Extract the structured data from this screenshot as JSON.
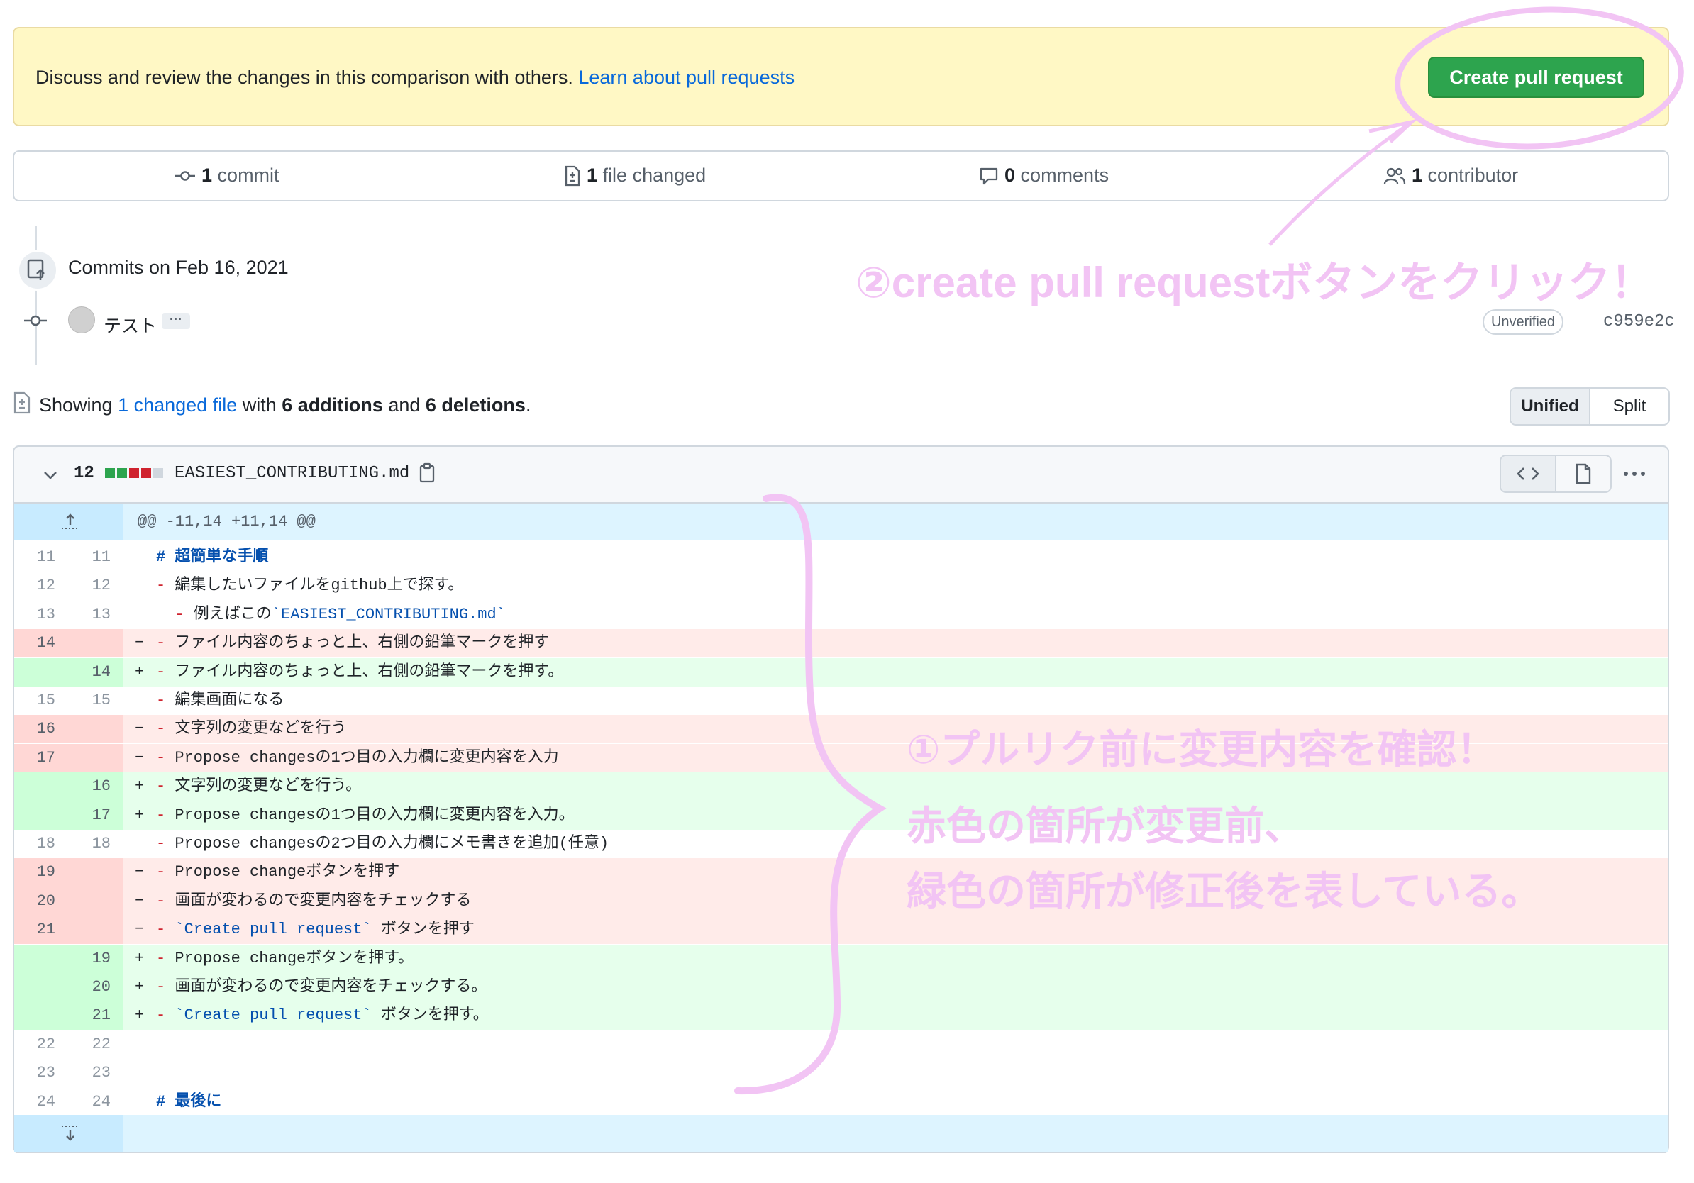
{
  "flash": {
    "text": "Discuss and review the changes in this comparison with others.",
    "link": "Learn about pull requests",
    "button": "Create pull request"
  },
  "summary": {
    "commits_n": "1",
    "commits_label": "commit",
    "files_n": "1",
    "files_label": "file changed",
    "comments_n": "0",
    "comments_label": "comments",
    "contributors_n": "1",
    "contributors_label": "contributor"
  },
  "timeline": {
    "commits_on": "Commits on Feb 16, 2021",
    "author": "テスト",
    "ellipsis": "···",
    "badge": "Unverified",
    "sha": "c959e2c"
  },
  "showing": {
    "prefix": "Showing",
    "link": "1 changed file",
    "mid": "with",
    "additions": "6 additions",
    "and": "and",
    "deletions": "6 deletions",
    "end": "."
  },
  "view_toggle": {
    "unified": "Unified",
    "split": "Split"
  },
  "file": {
    "change_count": "12",
    "name": "EASIEST_CONTRIBUTING.md",
    "stat_colors": [
      "#2da44e",
      "#2da44e",
      "#cf222e",
      "#cf222e",
      "#d0d7de"
    ]
  },
  "hunk_header": "@@ -11,14 +11,14 @@",
  "diff_lines": [
    {
      "type": "ctx",
      "old": "11",
      "new": "11",
      "sign": " ",
      "text": "# 超簡単な手順"
    },
    {
      "type": "ctx",
      "old": "12",
      "new": "12",
      "sign": " ",
      "text": "- 編集したいファイルをgithub上で探す。"
    },
    {
      "type": "ctx",
      "old": "13",
      "new": "13",
      "sign": " ",
      "text": "  - 例えばこの`EASIEST_CONTRIBUTING.md`"
    },
    {
      "type": "del",
      "old": "14",
      "new": "",
      "sign": "−",
      "text": "- ファイル内容のちょっと上、右側の鉛筆マークを押す"
    },
    {
      "type": "add",
      "old": "",
      "new": "14",
      "sign": "+",
      "text": "- ファイル内容のちょっと上、右側の鉛筆マークを押す。"
    },
    {
      "type": "ctx",
      "old": "15",
      "new": "15",
      "sign": " ",
      "text": "- 編集画面になる"
    },
    {
      "type": "del",
      "old": "16",
      "new": "",
      "sign": "−",
      "text": "- 文字列の変更などを行う"
    },
    {
      "type": "del",
      "old": "17",
      "new": "",
      "sign": "−",
      "text": "- Propose changesの1つ目の入力欄に変更内容を入力"
    },
    {
      "type": "add",
      "old": "",
      "new": "16",
      "sign": "+",
      "text": "- 文字列の変更などを行う。"
    },
    {
      "type": "add",
      "old": "",
      "new": "17",
      "sign": "+",
      "text": "- Propose changesの1つ目の入力欄に変更内容を入力。"
    },
    {
      "type": "ctx",
      "old": "18",
      "new": "18",
      "sign": " ",
      "text": "- Propose changesの2つ目の入力欄にメモ書きを追加(任意)"
    },
    {
      "type": "del",
      "old": "19",
      "new": "",
      "sign": "−",
      "text": "- Propose changeボタンを押す"
    },
    {
      "type": "del",
      "old": "20",
      "new": "",
      "sign": "−",
      "text": "- 画面が変わるので変更内容をチェックする"
    },
    {
      "type": "del",
      "old": "21",
      "new": "",
      "sign": "−",
      "text": "- `Create pull request` ボタンを押す"
    },
    {
      "type": "add",
      "old": "",
      "new": "19",
      "sign": "+",
      "text": "- Propose changeボタンを押す。"
    },
    {
      "type": "add",
      "old": "",
      "new": "20",
      "sign": "+",
      "text": "- 画面が変わるので変更内容をチェックする。"
    },
    {
      "type": "add",
      "old": "",
      "new": "21",
      "sign": "+",
      "text": "- `Create pull request` ボタンを押す。"
    },
    {
      "type": "ctx",
      "old": "22",
      "new": "22",
      "sign": " ",
      "text": ""
    },
    {
      "type": "ctx",
      "old": "23",
      "new": "23",
      "sign": " ",
      "text": ""
    },
    {
      "type": "ctx",
      "old": "24",
      "new": "24",
      "sign": " ",
      "text": "# 最後に"
    }
  ],
  "annotations": {
    "step2": "②create pull requestボタンをクリック！",
    "step1": "①プルリク前に変更内容を確認！",
    "red_note": "赤色の箇所が変更前、",
    "green_note": "緑色の箇所が修正後を表している。"
  },
  "icons": {
    "commit": "git-commit-icon",
    "file_diff": "file-diff-icon",
    "comment": "comment-icon",
    "people": "people-icon",
    "repo_push": "repo-push-icon",
    "chevron": "chevron-down-icon",
    "copy": "copy-icon",
    "code": "code-icon",
    "file": "file-icon",
    "kebab": "kebab-horizontal-icon",
    "expand_up": "fold-up-icon",
    "expand_down": "fold-down-icon"
  },
  "colors": {
    "create_button": "#2da44e",
    "del_bg": "#ffebe9",
    "add_bg": "#e6ffec",
    "annotation": "#f2c4f4",
    "link": "#0969da"
  }
}
